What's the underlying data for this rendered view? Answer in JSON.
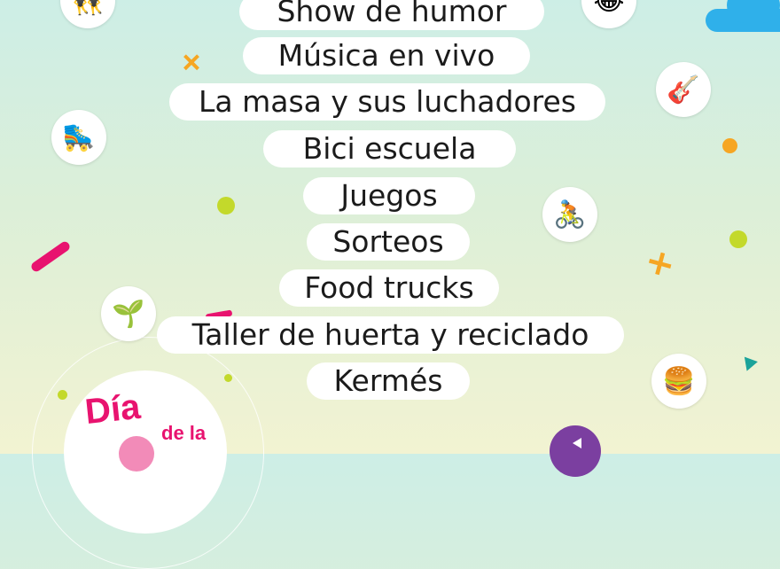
{
  "activities": [
    "Show de humor",
    "Música en vivo",
    "La masa y sus luchadores",
    "Bici escuela",
    "Juegos",
    "Sorteos",
    "Food trucks",
    "Taller de huerta y reciclado",
    "Kermés"
  ],
  "icons": {
    "dancers": "👯",
    "laughing": "😂",
    "guitar": "🎸",
    "roller_skate": "🛼",
    "cyclist": "🚴",
    "seedling": "🌱",
    "burger": "🍔"
  },
  "logo": {
    "line1": "Día",
    "line2": "de la"
  },
  "colors": {
    "accent_pink": "#e8136f",
    "accent_orange": "#f6a623",
    "accent_lime": "#c3d92b",
    "accent_blue": "#2fb0ea",
    "accent_purple": "#7b3fa0"
  }
}
